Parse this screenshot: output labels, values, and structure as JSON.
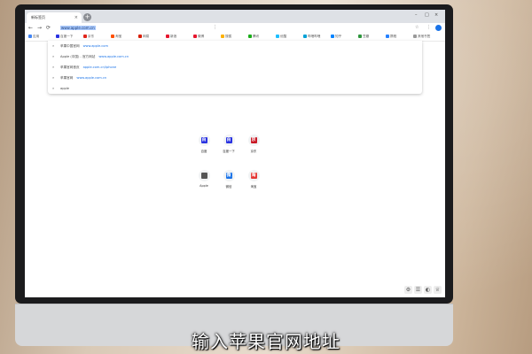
{
  "browser": {
    "tab_title": "新标签页",
    "tab_close": "×",
    "new_tab": "+",
    "window_controls": [
      "–",
      "□",
      "×"
    ],
    "nav": {
      "back": "←",
      "forward": "→",
      "reload": "⟳"
    },
    "address_text": "www.apple.com.cn",
    "address_icons": [
      "⋮",
      "☆",
      "⋮"
    ]
  },
  "bookmarks": [
    {
      "label": "应用",
      "color": "#4285f4"
    },
    {
      "label": "百度一下",
      "color": "#2932e1"
    },
    {
      "label": "京东",
      "color": "#e1251b"
    },
    {
      "label": "淘宝",
      "color": "#ff5000"
    },
    {
      "label": "网易",
      "color": "#d81e06"
    },
    {
      "label": "新浪",
      "color": "#e6162d"
    },
    {
      "label": "微博",
      "color": "#e6162d"
    },
    {
      "label": "搜狐",
      "color": "#fdb100"
    },
    {
      "label": "腾讯",
      "color": "#1aad19"
    },
    {
      "label": "优酷",
      "color": "#1ebeff"
    },
    {
      "label": "哔哩哔哩",
      "color": "#00a1d6"
    },
    {
      "label": "知乎",
      "color": "#0084ff"
    },
    {
      "label": "豆瓣",
      "color": "#2e963d"
    },
    {
      "label": "携程",
      "color": "#2681ff"
    },
    {
      "label": "其他书签",
      "color": "#999999"
    }
  ],
  "suggestions": [
    {
      "icon": "⌕",
      "text": "苹果中国官网",
      "url": "www.apple.com"
    },
    {
      "icon": "⌕",
      "text": "Apple (中国) - 官方网站",
      "url": "www.apple.com.cn"
    },
    {
      "icon": "⌕",
      "text": "苹果官网首页",
      "url": "apple.com.cn/iphone"
    },
    {
      "icon": "⌕",
      "text": "苹果官网",
      "url": "www.apple.com.cn"
    },
    {
      "icon": "⌕",
      "text": "apple"
    }
  ],
  "tiles": [
    {
      "label": "百度",
      "icon": "百",
      "color": "#2932e1"
    },
    {
      "label": "百度一下",
      "icon": "百",
      "color": "#2932e1"
    },
    {
      "label": "京东",
      "icon": "京",
      "color": "#c81623"
    },
    {
      "label": "Apple",
      "icon": "",
      "color": "#555555"
    },
    {
      "label": "微信",
      "icon": "微",
      "color": "#1a73e8"
    },
    {
      "label": "淘宝",
      "icon": "淘",
      "color": "#e53935"
    }
  ],
  "bottom_icons": [
    "⚙",
    "☰",
    "◐",
    "♕"
  ],
  "caption": "输入苹果官网地址"
}
